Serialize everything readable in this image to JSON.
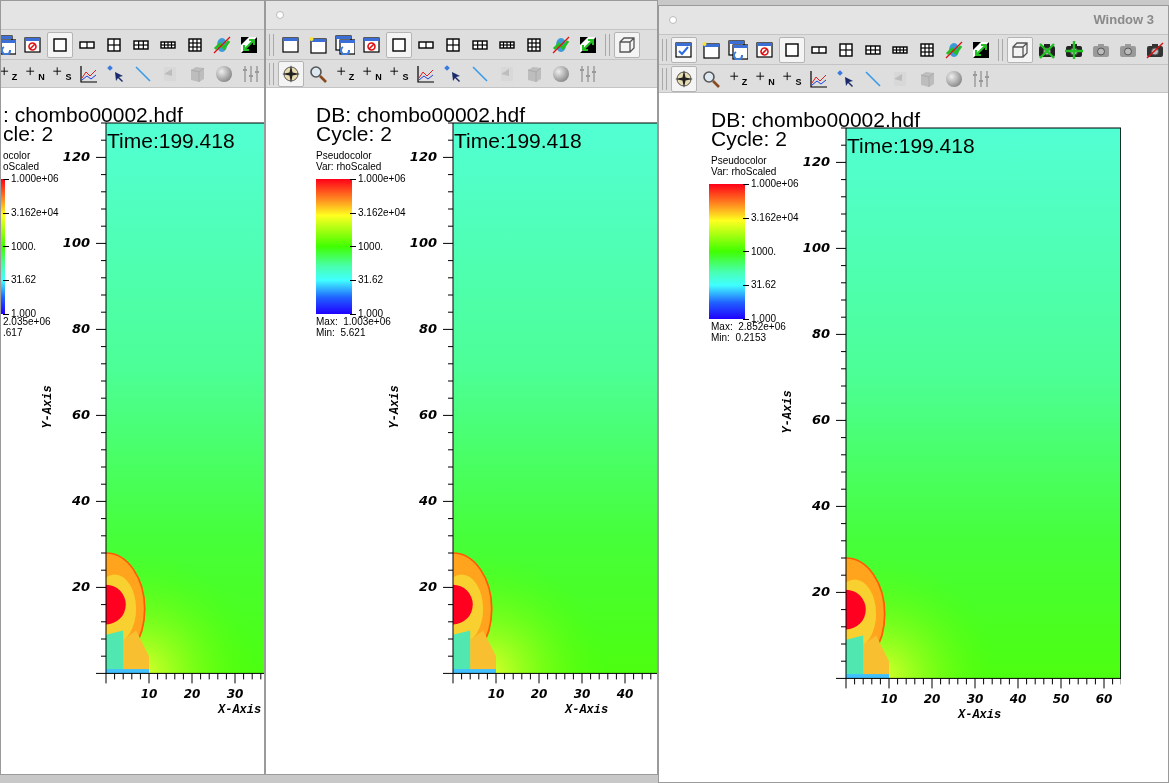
{
  "windows": [
    {
      "toolbars": [
        [
          [
            {
              "kind": "clonewindow",
              "selected": false
            },
            {
              "kind": "deletewindow",
              "selected": false
            },
            {
              "kind": "layout1",
              "selected": true
            },
            {
              "kind": "layout2",
              "selected": false
            },
            {
              "kind": "layout4",
              "selected": false
            },
            {
              "kind": "layout6",
              "selected": false
            },
            {
              "kind": "layout8",
              "selected": false
            },
            {
              "kind": "layout9",
              "selected": false
            },
            {
              "kind": "lockview",
              "selected": false
            },
            {
              "kind": "locktime",
              "selected": false
            }
          ]
        ],
        [
          [
            {
              "kind": "plus",
              "label": "Z",
              "selected": false
            },
            {
              "kind": "plus",
              "label": "N",
              "selected": false
            },
            {
              "kind": "plus",
              "label": "S",
              "selected": false
            },
            {
              "kind": "curve",
              "selected": false
            },
            {
              "kind": "pick",
              "selected": false
            },
            {
              "kind": "line",
              "selected": false
            },
            {
              "kind": "lineout",
              "selected": false
            },
            {
              "kind": "box",
              "selected": false
            },
            {
              "kind": "sphere",
              "selected": false
            },
            {
              "kind": "sliders",
              "selected": false
            }
          ]
        ]
      ],
      "plot": {
        "db": ": chombo00002.hdf",
        "cycle": "cle: 2",
        "time": "Time:199.418",
        "legend": {
          "title": "ocolor",
          "var": "oScaled",
          "ticks": [
            "1.000e+06",
            "3.162e+04",
            "1000.",
            "31.62",
            "1.000"
          ],
          "max": "2.035e+06",
          "min": ".617"
        },
        "y_axis": {
          "label": "Y-Axis",
          "ticks": [
            "120",
            "100",
            "80",
            "60",
            "40",
            "20"
          ]
        },
        "x_axis": {
          "label": "X-Axis",
          "ticks": [
            "10",
            "20",
            "30"
          ]
        }
      }
    },
    {
      "toolbars": [
        [
          [
            {
              "kind": "window",
              "selected": false
            },
            {
              "kind": "newwindow",
              "selected": false
            },
            {
              "kind": "clonewindow",
              "selected": false
            },
            {
              "kind": "deletewindow",
              "selected": false
            },
            {
              "kind": "layout1",
              "selected": true
            },
            {
              "kind": "layout2",
              "selected": false
            },
            {
              "kind": "layout4",
              "selected": false
            },
            {
              "kind": "layout6",
              "selected": false
            },
            {
              "kind": "layout8",
              "selected": false
            },
            {
              "kind": "layout9",
              "selected": false
            },
            {
              "kind": "lockview",
              "selected": false
            },
            {
              "kind": "locktime",
              "selected": false
            }
          ],
          [
            {
              "kind": "perspective",
              "selected": true
            }
          ]
        ],
        [
          [
            {
              "kind": "navigate",
              "selected": true
            },
            {
              "kind": "zoom",
              "selected": false
            },
            {
              "kind": "plus",
              "label": "Z",
              "selected": false
            },
            {
              "kind": "plus",
              "label": "N",
              "selected": false
            },
            {
              "kind": "plus",
              "label": "S",
              "selected": false
            },
            {
              "kind": "curve",
              "selected": false
            },
            {
              "kind": "pick",
              "selected": false
            },
            {
              "kind": "line",
              "selected": false
            },
            {
              "kind": "lineout",
              "selected": false
            },
            {
              "kind": "box",
              "selected": false
            },
            {
              "kind": "sphere",
              "selected": false
            },
            {
              "kind": "sliders",
              "selected": false
            }
          ]
        ]
      ],
      "plot": {
        "db": "DB: chombo00002.hdf",
        "cycle": "Cycle: 2",
        "time": "Time:199.418",
        "legend": {
          "title": "Pseudocolor",
          "var": "Var: rhoScaled",
          "ticks": [
            "1.000e+06",
            "3.162e+04",
            "1000.",
            "31.62",
            "1.000"
          ],
          "max": "Max:  1.003e+06",
          "min": "Min:  5.621"
        },
        "y_axis": {
          "label": "Y-Axis",
          "ticks": [
            "120",
            "100",
            "80",
            "60",
            "40",
            "20"
          ]
        },
        "x_axis": {
          "label": "X-Axis",
          "ticks": [
            "10",
            "20",
            "30",
            "40"
          ]
        }
      }
    },
    {
      "title": "Window 3",
      "toolbars": [
        [
          [
            {
              "kind": "activewindow",
              "selected": true
            },
            {
              "kind": "newwindow",
              "selected": false
            },
            {
              "kind": "clonewindow",
              "selected": false
            },
            {
              "kind": "deletewindow",
              "selected": false
            },
            {
              "kind": "layout1",
              "selected": true
            },
            {
              "kind": "layout2",
              "selected": false
            },
            {
              "kind": "layout4",
              "selected": false
            },
            {
              "kind": "layout6",
              "selected": false
            },
            {
              "kind": "layout8",
              "selected": false
            },
            {
              "kind": "layout9",
              "selected": false
            },
            {
              "kind": "lockview",
              "selected": false
            },
            {
              "kind": "locktime",
              "selected": false
            }
          ],
          [
            {
              "kind": "perspective",
              "selected": true
            },
            {
              "kind": "camerax",
              "selected": false
            },
            {
              "kind": "cameragreen",
              "selected": false
            },
            {
              "kind": "camera",
              "selected": false
            },
            {
              "kind": "camera",
              "selected": false
            },
            {
              "kind": "cameracrossed",
              "selected": false
            }
          ]
        ],
        [
          [
            {
              "kind": "navigate",
              "selected": true
            },
            {
              "kind": "zoom",
              "selected": false
            },
            {
              "kind": "plus",
              "label": "Z",
              "selected": false
            },
            {
              "kind": "plus",
              "label": "N",
              "selected": false
            },
            {
              "kind": "plus",
              "label": "S",
              "selected": false
            },
            {
              "kind": "curve",
              "selected": false
            },
            {
              "kind": "pick",
              "selected": false
            },
            {
              "kind": "line",
              "selected": false
            },
            {
              "kind": "lineout",
              "selected": false
            },
            {
              "kind": "box",
              "selected": false
            },
            {
              "kind": "sphere",
              "selected": false
            },
            {
              "kind": "sliders",
              "selected": false
            }
          ]
        ]
      ],
      "plot": {
        "db": "DB: chombo00002.hdf",
        "cycle": "Cycle: 2",
        "time": "Time:199.418",
        "legend": {
          "title": "Pseudocolor",
          "var": "Var: rhoScaled",
          "ticks": [
            "1.000e+06",
            "3.162e+04",
            "1000.",
            "31.62",
            "1.000"
          ],
          "max": "Max:  2.852e+06",
          "min": "Min:  0.2153"
        },
        "y_axis": {
          "label": "Y-Axis",
          "ticks": [
            "120",
            "100",
            "80",
            "60",
            "40",
            "20"
          ]
        },
        "x_axis": {
          "label": "X-Axis",
          "ticks": [
            "10",
            "20",
            "30",
            "40",
            "50",
            "60"
          ]
        }
      }
    }
  ]
}
